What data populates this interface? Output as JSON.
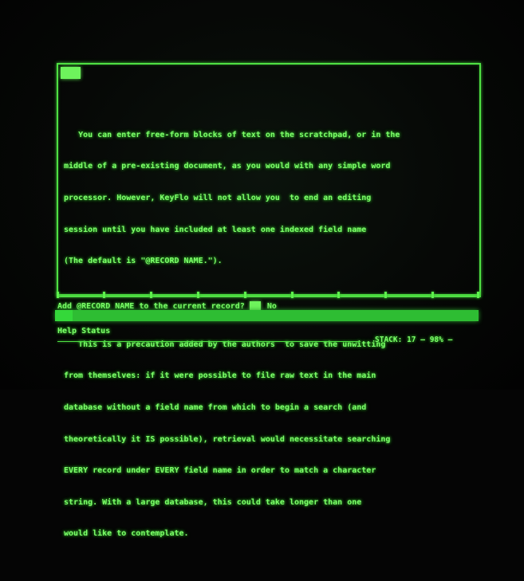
{
  "document": {
    "paragraph1": [
      "You can enter free-form blocks of text on the scratchpad, or in the",
      "middle of a pre-existing document, as you would with any simple word",
      "processor. However, KeyFlo will not allow you  to end an editing",
      "session until you have included at least one indexed field name",
      "(The default is \"@RECORD NAME.\")."
    ],
    "paragraph2": [
      "This is a precaution added by the authors  to save the unwitting",
      "from themselves: if it were possible to file raw text in the main",
      "database without a field name from which to begin a search (and",
      "theoretically it IS possible), retrieval would necessitate searching",
      "EVERY record under EVERY field name in order to match a character",
      "string. With a large database, this could take longer than one",
      "would like to contemplate."
    ]
  },
  "prompt": {
    "question": "Add @RECORD NAME to the current record?",
    "answer_no": "No"
  },
  "help_line": {
    "label": "Help Status"
  },
  "status": {
    "stack_label": "STACK:",
    "stack_value": "17",
    "percent": "98%"
  },
  "colors": {
    "phosphor": "#7dff6a",
    "frame": "#4fe043",
    "highlight": "#2ebd33",
    "background": "#050505"
  }
}
